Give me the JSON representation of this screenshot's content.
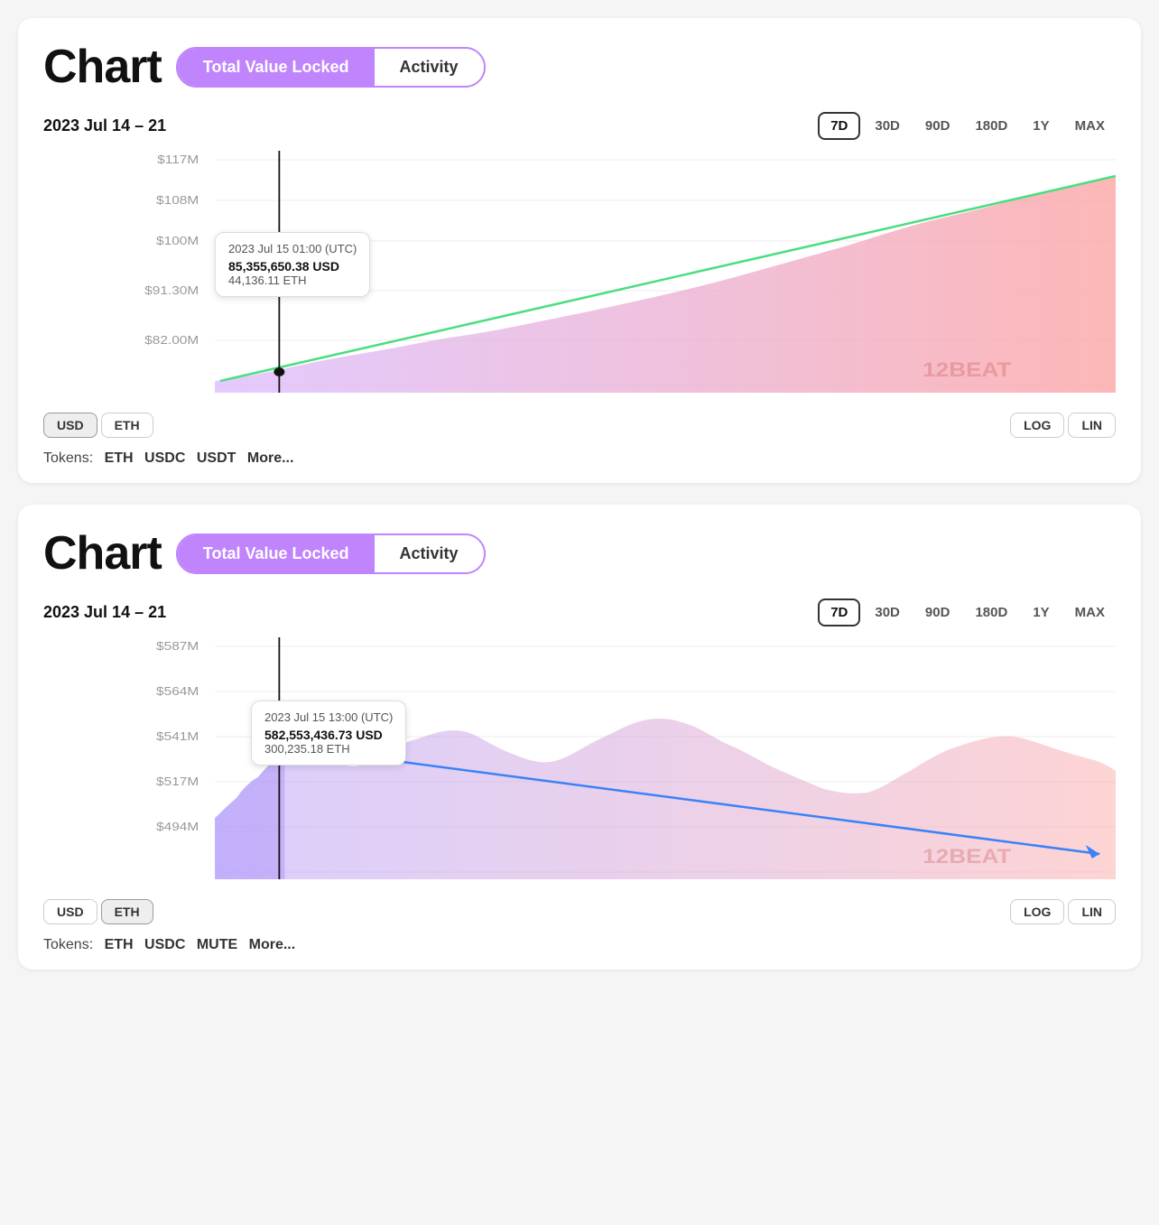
{
  "charts": [
    {
      "id": "chart1",
      "title": "Chart",
      "tabs": [
        {
          "label": "Total Value Locked",
          "active": true
        },
        {
          "label": "Activity",
          "active": false
        }
      ],
      "dateRange": "2023 Jul 14 – 21",
      "periods": [
        "7D",
        "30D",
        "90D",
        "180D",
        "1Y",
        "MAX"
      ],
      "activePeriod": "7D",
      "tooltip": {
        "date": "2023 Jul 15 01:00 (UTC)",
        "usd": "85,355,650.38 USD",
        "eth": "44,136.11 ETH"
      },
      "yLabels": [
        "$117M",
        "$108M",
        "$100M",
        "$91.30M",
        "$82.00M"
      ],
      "currencies": [
        "USD",
        "ETH"
      ],
      "activeCurrency": "USD",
      "scales": [
        "LOG",
        "LIN"
      ],
      "tokens": [
        "ETH",
        "USDC",
        "USDT"
      ],
      "moreLabel": "More..."
    },
    {
      "id": "chart2",
      "title": "Chart",
      "tabs": [
        {
          "label": "Total Value Locked",
          "active": true
        },
        {
          "label": "Activity",
          "active": false
        }
      ],
      "dateRange": "2023 Jul 14 – 21",
      "periods": [
        "7D",
        "30D",
        "90D",
        "180D",
        "1Y",
        "MAX"
      ],
      "activePeriod": "7D",
      "tooltip": {
        "date": "2023 Jul 15 13:00 (UTC)",
        "usd": "582,553,436.73 USD",
        "eth": "300,235.18 ETH"
      },
      "yLabels": [
        "$587M",
        "$564M",
        "$541M",
        "$517M",
        "$494M"
      ],
      "currencies": [
        "USD",
        "ETH"
      ],
      "activeCurrency": "ETH",
      "scales": [
        "LOG",
        "LIN"
      ],
      "tokens": [
        "ETH",
        "USDC",
        "MUTE"
      ],
      "moreLabel": "More..."
    }
  ]
}
